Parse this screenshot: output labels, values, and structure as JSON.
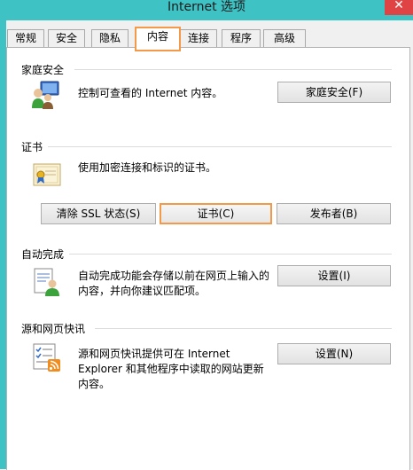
{
  "window": {
    "title": "Internet 选项",
    "close_glyph": "✕"
  },
  "tabs": [
    {
      "label": "常规"
    },
    {
      "label": "安全"
    },
    {
      "label": "隐私"
    },
    {
      "label": "内容",
      "selected": true
    },
    {
      "label": "连接"
    },
    {
      "label": "程序"
    },
    {
      "label": "高级"
    }
  ],
  "family_safety": {
    "heading": "家庭安全",
    "description": "控制可查看的 Internet 内容。",
    "button": "家庭安全(F)",
    "icon": "family-safety-users-icon"
  },
  "certificates": {
    "heading": "证书",
    "description": "使用加密连接和标识的证书。",
    "icon": "certificate-icon",
    "buttons": {
      "clear_ssl": "清除 SSL 状态(S)",
      "certificates": "证书(C)",
      "publishers": "发布者(B)"
    }
  },
  "autocomplete": {
    "heading": "自动完成",
    "description_line1": "自动完成功能会存储以前在网页上输入的",
    "description_line2": "内容，并向你建议匹配项。",
    "button": "设置(I)",
    "icon": "autocomplete-form-user-icon"
  },
  "feeds": {
    "heading": "源和网页快讯",
    "description_line1": "源和网页快讯提供可在 Internet",
    "description_line2": "Explorer 和其他程序中读取的网站更新",
    "description_line3": "内容。",
    "button": "设置(N)",
    "icon": "feeds-list-rss-icon"
  },
  "colors": {
    "title_bar": "#3ec2c4",
    "highlight": "#f29a4a",
    "close": "#e04343"
  }
}
